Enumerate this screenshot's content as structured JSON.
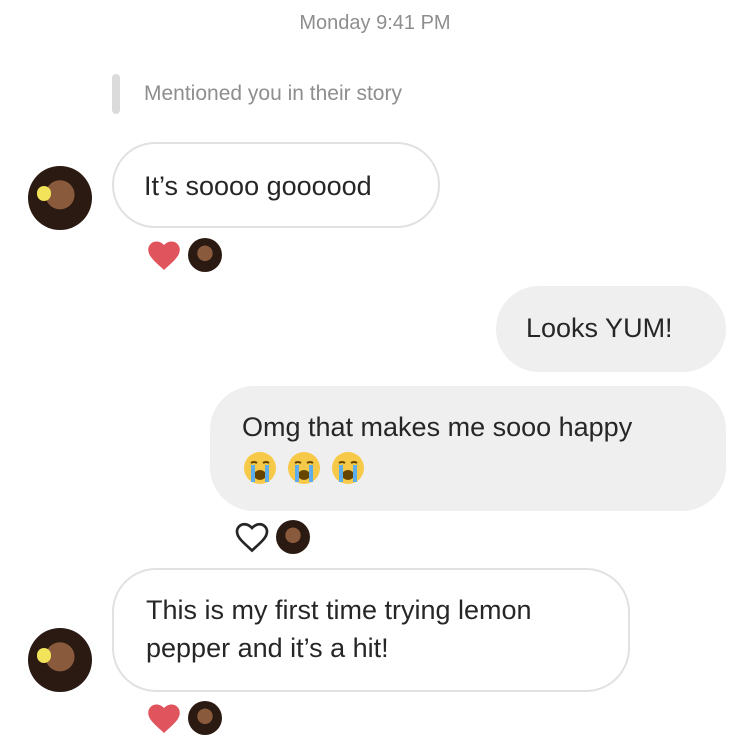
{
  "timestamp": "Monday 9:41 PM",
  "story_mention": "Mentioned you in their story",
  "messages": [
    {
      "direction": "in",
      "text": "It’s soooo goooood",
      "reaction": "heart-filled"
    },
    {
      "direction": "out",
      "text": "Looks YUM!"
    },
    {
      "direction": "out",
      "text": "Omg that makes me sooo happy",
      "emoji": [
        "loudly-crying-face",
        "loudly-crying-face",
        "loudly-crying-face"
      ],
      "reaction": "heart-outline"
    },
    {
      "direction": "in",
      "text": "This is my first time trying lemon pepper and it’s a hit!",
      "reaction": "heart-filled"
    }
  ],
  "colors": {
    "incoming_bubble_border": "#e1e1e1",
    "outgoing_bubble": "#efefef",
    "heart": "#e0545e",
    "meta_text": "#8e8e8e"
  }
}
